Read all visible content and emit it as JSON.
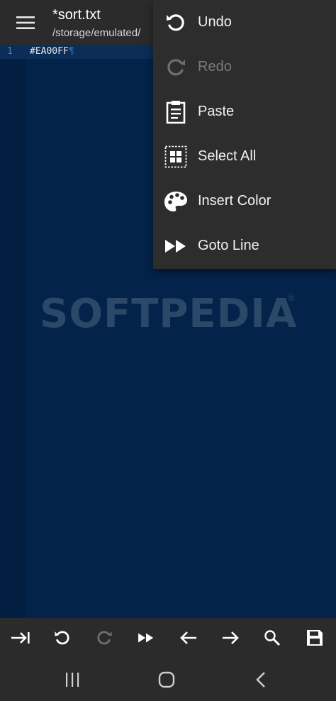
{
  "header": {
    "title": "*sort.txt",
    "path": "/storage/emulated/"
  },
  "editor": {
    "lines": [
      {
        "number": "1",
        "text": "#EA00FF",
        "end_marker": "¶"
      }
    ],
    "watermark": "SOFTPEDIA",
    "watermark_mark": "®"
  },
  "context_menu": {
    "items": [
      {
        "label": "Undo",
        "icon": "undo-icon",
        "enabled": true
      },
      {
        "label": "Redo",
        "icon": "redo-icon",
        "enabled": false
      },
      {
        "label": "Paste",
        "icon": "clipboard-icon",
        "enabled": true
      },
      {
        "label": "Select All",
        "icon": "select-all-icon",
        "enabled": true
      },
      {
        "label": "Insert Color",
        "icon": "palette-icon",
        "enabled": true
      },
      {
        "label": "Goto Line",
        "icon": "fast-forward-icon",
        "enabled": true
      }
    ]
  },
  "bottom_toolbar": {
    "tools": [
      "tab-icon",
      "undo-icon",
      "redo-icon",
      "fast-forward-icon",
      "arrow-left-icon",
      "arrow-right-icon",
      "search-icon",
      "save-icon"
    ]
  },
  "colors": {
    "editor_background": "#03234a",
    "bar_background": "#2b2b2b",
    "menu_background": "#2d2d2d",
    "disabled_text": "#7a7a7a"
  }
}
